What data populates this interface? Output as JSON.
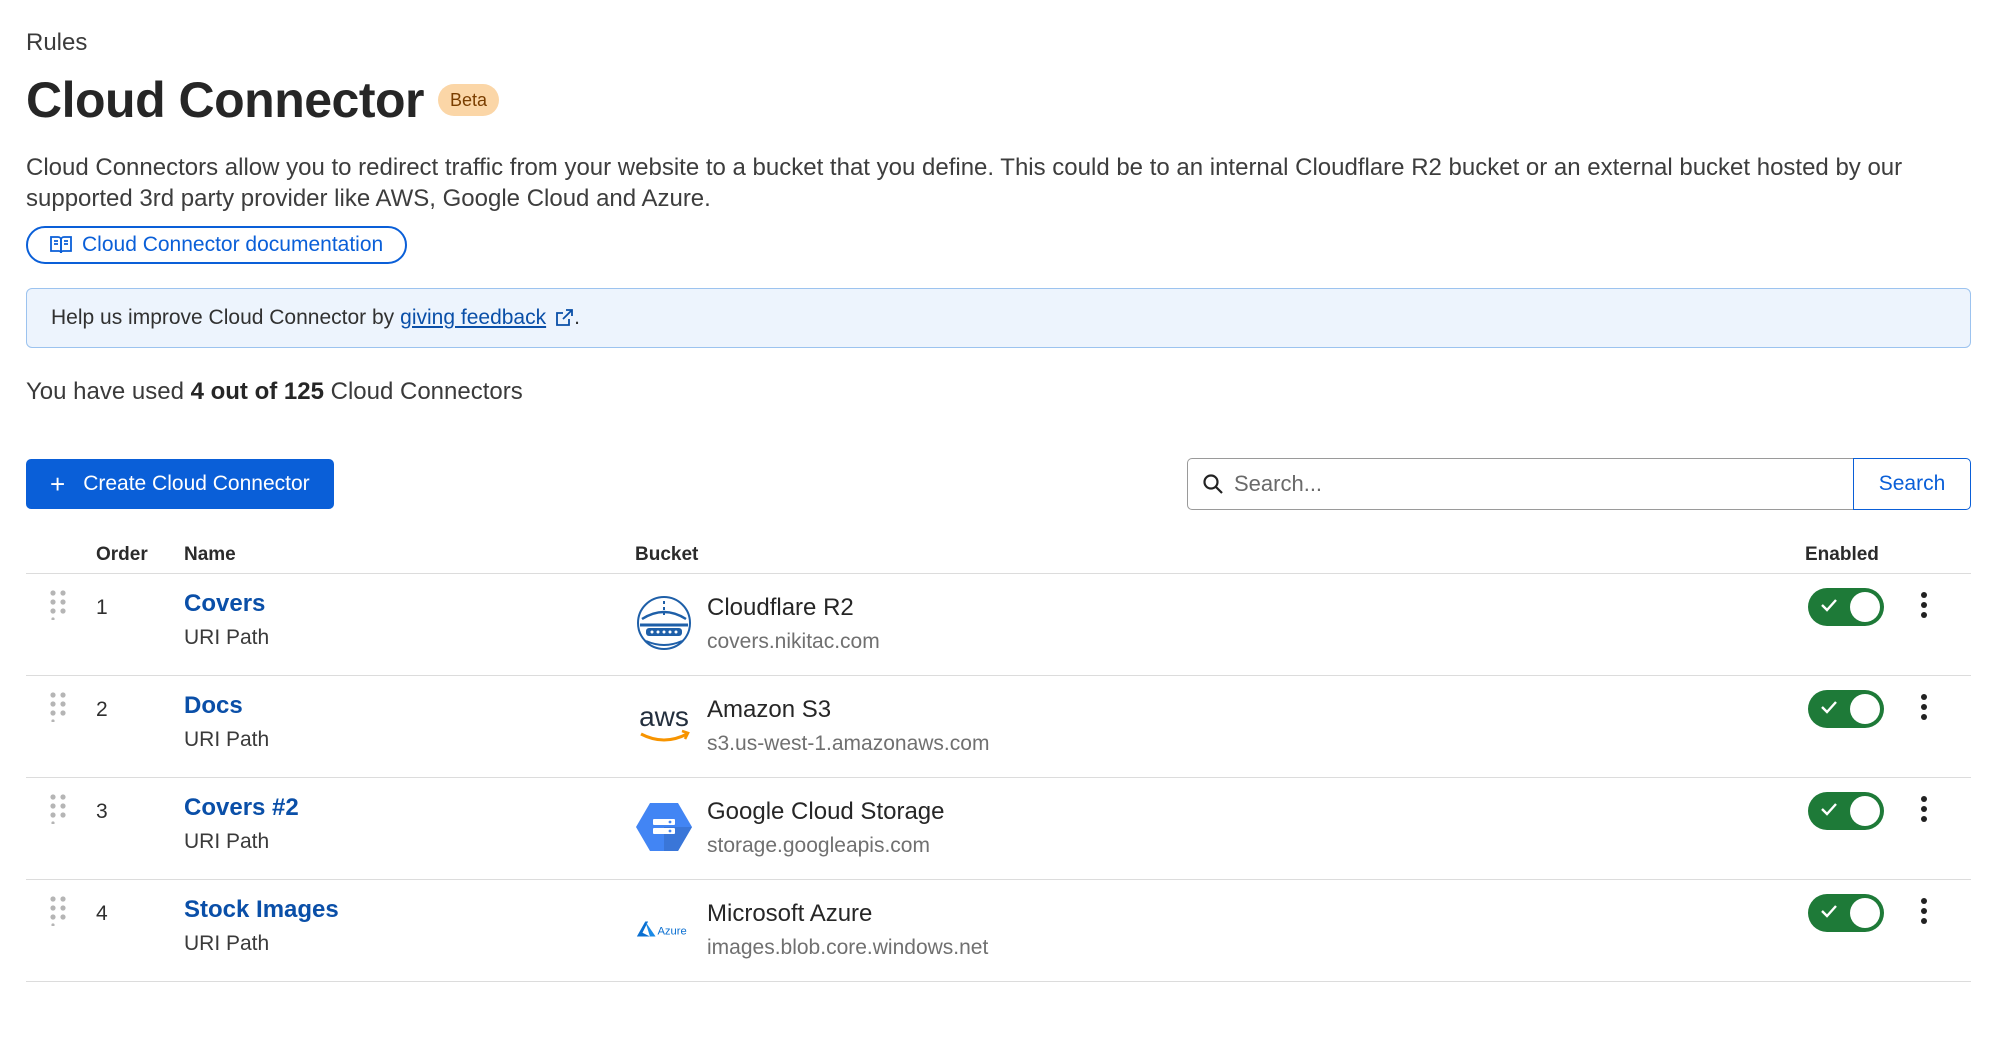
{
  "breadcrumb": "Rules",
  "title": "Cloud Connector",
  "badge": "Beta",
  "description": "Cloud Connectors allow you to redirect traffic from your website to a bucket that you define. This could be to an internal Cloudflare R2 bucket or an external bucket hosted by our supported 3rd party provider like AWS, Google Cloud and Azure.",
  "doc_link": {
    "label": "Cloud Connector documentation",
    "icon": "book-icon"
  },
  "banner": {
    "prefix": "Help us improve Cloud Connector by",
    "link": "giving feedback",
    "suffix": ".",
    "icon": "external-link-icon"
  },
  "usage": {
    "prefix": "You have used",
    "count": "4 out of 125",
    "suffix": "Cloud Connectors"
  },
  "create_button": {
    "label": "Create Cloud Connector",
    "icon": "plus-icon"
  },
  "search": {
    "placeholder": "Search...",
    "button": "Search",
    "icon": "search-icon"
  },
  "table": {
    "headers": {
      "order": "Order",
      "name": "Name",
      "bucket": "Bucket",
      "enabled": "Enabled"
    },
    "rows": [
      {
        "order": "1",
        "name": "Covers",
        "type": "URI Path",
        "provider": "Cloudflare R2",
        "host": "covers.nikitac.com",
        "logo": "cloudflare-r2-logo",
        "enabled": true
      },
      {
        "order": "2",
        "name": "Docs",
        "type": "URI Path",
        "provider": "Amazon S3",
        "host": "s3.us-west-1.amazonaws.com",
        "logo": "aws-logo",
        "logo_text": "aws",
        "enabled": true
      },
      {
        "order": "3",
        "name": "Covers #2",
        "type": "URI Path",
        "provider": "Google Cloud Storage",
        "host": "storage.googleapis.com",
        "logo": "google-cloud-storage-logo",
        "enabled": true
      },
      {
        "order": "4",
        "name": "Stock Images",
        "type": "URI Path",
        "provider": "Microsoft Azure",
        "host": "images.blob.core.windows.net",
        "logo": "azure-logo",
        "logo_text": "Azure",
        "enabled": true
      }
    ]
  },
  "colors": {
    "accent": "#0a5fd8",
    "toggle_on": "#1e7a38",
    "badge_bg": "#fbd6a7",
    "banner_bg": "#edf4fd"
  }
}
